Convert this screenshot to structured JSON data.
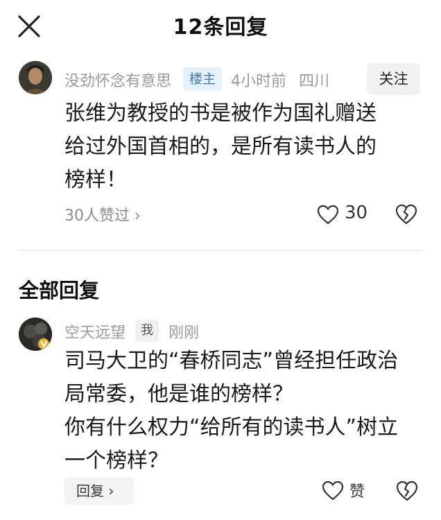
{
  "header": {
    "title": "12条回复"
  },
  "root_comment": {
    "username": "没劲怀念有意思",
    "badge": "楼主",
    "time": "4小时前",
    "region": "四川",
    "follow_label": "关注",
    "lines": [
      "张维为教授的书是被作为国礼赠送",
      "给过外国首相的，是所有读书人的",
      "榜样！"
    ],
    "likers": "30人赞过 ›",
    "like_count": "30"
  },
  "section": {
    "title": "全部回复"
  },
  "reply": {
    "username": "空天远望",
    "badge": "我",
    "time": "刚刚",
    "lines": [
      "司马大卫的“春桥同志”曾经担任政治",
      "局常委，他是谁的榜样？",
      "你有什么权力“给所有的读书人”树立",
      "一个榜样？"
    ],
    "reply_label": "回复 ›",
    "like_label": "赞"
  },
  "icons": {
    "close": "close-icon",
    "heart": "heart-outline-icon",
    "dislike": "broken-heart-icon"
  },
  "colors": {
    "badge_bg": "#e6f1fc",
    "badge_text": "#3a77c2",
    "meta_text": "#9a9a9a"
  }
}
